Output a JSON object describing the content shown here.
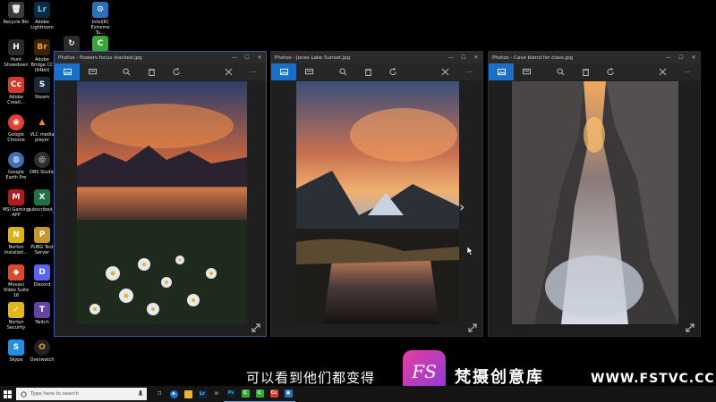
{
  "desktop_icons": [
    {
      "label": "Recycle Bin",
      "glyph": "🗑",
      "color": "#3b3b3b"
    },
    {
      "label": "Adobe Lightroom",
      "glyph": "Lr",
      "color": "#0a2a44"
    },
    {
      "label": "Intel(R) Extreme Tu...",
      "glyph": "⚙",
      "color": "#2d6fb8"
    },
    {
      "label": "Hunt Showdown",
      "glyph": "H",
      "color": "#2a2a2a"
    },
    {
      "label": "Adobe Bridge CC (64bit)",
      "glyph": "Br",
      "color": "#3d2305"
    },
    {
      "label": "",
      "glyph": "↻",
      "color": "#2a2a2a"
    },
    {
      "label": "",
      "glyph": "C",
      "color": "#3aa63a"
    },
    {
      "label": "Adobe Creati...",
      "glyph": "Cc",
      "color": "#d23a2a"
    },
    {
      "label": "Steam",
      "glyph": "S",
      "color": "#1b2838"
    },
    {
      "label": "Google Chrome",
      "glyph": "◉",
      "color": "#e34133"
    },
    {
      "label": "VLC media player",
      "glyph": "▲",
      "color": "#f08a1c"
    },
    {
      "label": "Google Earth Pro",
      "glyph": "◍",
      "color": "#3d6fb5"
    },
    {
      "label": "OBS Studio",
      "glyph": "◎",
      "color": "#302e31"
    },
    {
      "label": "MSI Gaming APP",
      "glyph": "M",
      "color": "#b01c1c"
    },
    {
      "label": "subscribed_...",
      "glyph": "X",
      "color": "#1f7244"
    },
    {
      "label": "Norton Installati...",
      "glyph": "N",
      "color": "#d8b41a"
    },
    {
      "label": "PUBG Test Server",
      "glyph": "P",
      "color": "#c2992f"
    },
    {
      "label": "Movavi Video Suite 16",
      "glyph": "◆",
      "color": "#d84a2a"
    },
    {
      "label": "Discord",
      "glyph": "D",
      "color": "#5865f2"
    },
    {
      "label": "Norton Security",
      "glyph": "✓",
      "color": "#e0b818"
    },
    {
      "label": "Twitch",
      "glyph": "T",
      "color": "#6441a5"
    },
    {
      "label": "Skype",
      "glyph": "S",
      "color": "#1f8fe0"
    },
    {
      "label": "Overwatch",
      "glyph": "O",
      "color": "#e89a2a"
    }
  ],
  "windows": [
    {
      "title": "Photos - flowers focus stacked.jpg",
      "minimize": "—",
      "maximize": "☐",
      "close": "✕",
      "more": "···"
    },
    {
      "title": "Photos - Jones Lake Sunset.jpg",
      "minimize": "—",
      "maximize": "☐",
      "close": "✕",
      "more": "···",
      "next_arrow": "›"
    },
    {
      "title": "Photos - Cave blend for class.jpg",
      "minimize": "—",
      "maximize": "☐",
      "close": "✕",
      "more": "···"
    }
  ],
  "subtitle": "可以看到他们都变得",
  "watermark": {
    "logo_text": "FS",
    "name": "梵摄创意库",
    "site": "WWW.FSTVC.CC"
  },
  "taskbar": {
    "search_placeholder": "Type here to search",
    "apps": [
      {
        "name": "task-view",
        "glyph": "❐",
        "color": "#151515"
      },
      {
        "name": "edge",
        "glyph": "e",
        "color": "#1e74c9"
      },
      {
        "name": "file-explorer",
        "glyph": "▬",
        "color": "#e8b73a"
      },
      {
        "name": "lightroom",
        "glyph": "Lr",
        "color": "#0a2a44"
      },
      {
        "name": "mail",
        "glyph": "✉",
        "color": "#151515"
      },
      {
        "name": "photoshop",
        "glyph": "Ps",
        "color": "#0a2236"
      },
      {
        "name": "camtasia",
        "glyph": "C",
        "color": "#3aa63a"
      },
      {
        "name": "camtasia-2",
        "glyph": "C",
        "color": "#3aa63a"
      },
      {
        "name": "creative-cloud",
        "glyph": "Cc",
        "color": "#d23a2a"
      },
      {
        "name": "photos",
        "glyph": "▣",
        "color": "#2d6fb8"
      }
    ]
  }
}
